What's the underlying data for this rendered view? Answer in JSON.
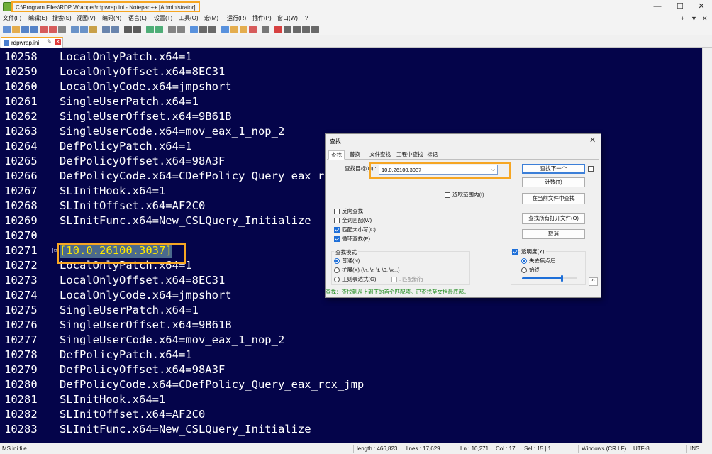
{
  "window": {
    "title": "C:\\Program Files\\RDP Wrapper\\rdpwrap.ini - Notepad++ [Administrator]",
    "minimize": "—",
    "maximize": "☐",
    "close": "✕"
  },
  "menu": {
    "items": [
      "文件(F)",
      "编辑(E)",
      "搜索(S)",
      "视图(V)",
      "编码(N)",
      "语言(L)",
      "设置(T)",
      "工具(O)",
      "宏(M)",
      "运行(R)",
      "插件(P)",
      "窗口(W)",
      "?"
    ],
    "right": [
      "+",
      "▼",
      "✕"
    ]
  },
  "toolbar": {
    "icons": [
      "new-file-icon",
      "open-file-icon",
      "save-icon",
      "save-all-icon",
      "close-icon",
      "close-all-icon",
      "print-icon",
      "cut-icon",
      "copy-icon",
      "paste-icon",
      "undo-icon",
      "redo-icon",
      "find-icon",
      "replace-icon",
      "zoom-in-icon",
      "zoom-out-icon",
      "sync-v-icon",
      "sync-h-icon",
      "word-wrap-icon",
      "show-all-icon",
      "indent-guide-icon",
      "udl-icon",
      "doc-map-icon",
      "function-list-icon",
      "folder-workspace-icon",
      "monitor-icon",
      "record-macro-icon",
      "stop-macro-icon",
      "play-macro-icon",
      "run-macro-icon",
      "save-macro-icon"
    ],
    "colors": [
      "#4a7fcf",
      "#e0a030",
      "#3a6fbf",
      "#3a6fbf",
      "#d04040",
      "#d04040",
      "#707070",
      "#5080c0",
      "#5080c0",
      "#c0902a",
      "#5070a0",
      "#5070a0",
      "#404040",
      "#404040",
      "#30a060",
      "#30a060",
      "#707070",
      "#707070",
      "#3c7fd8",
      "#505050",
      "#505050",
      "#3c7fd8",
      "#e0a030",
      "#e0a030",
      "#d04040",
      "#606060",
      "#d02020",
      "#505050",
      "#505050",
      "#505050",
      "#505050"
    ]
  },
  "tab": {
    "label": "rdpwrap.ini",
    "pin": "✎",
    "close": "✕"
  },
  "editor": {
    "lines": [
      {
        "num": "10258",
        "code": "LocalOnlyPatch.x64=1"
      },
      {
        "num": "10259",
        "code": "LocalOnlyOffset.x64=8EC31"
      },
      {
        "num": "10260",
        "code": "LocalOnlyCode.x64=jmpshort"
      },
      {
        "num": "10261",
        "code": "SingleUserPatch.x64=1"
      },
      {
        "num": "10262",
        "code": "SingleUserOffset.x64=9B61B"
      },
      {
        "num": "10263",
        "code": "SingleUserCode.x64=mov_eax_1_nop_2"
      },
      {
        "num": "10264",
        "code": "DefPolicyPatch.x64=1"
      },
      {
        "num": "10265",
        "code": "DefPolicyOffset.x64=98A3F"
      },
      {
        "num": "10266",
        "code": "DefPolicyCode.x64=CDefPolicy_Query_eax_rcx_jmp"
      },
      {
        "num": "10267",
        "code": "SLInitHook.x64=1"
      },
      {
        "num": "10268",
        "code": "SLInitOffset.x64=AF2C0"
      },
      {
        "num": "10269",
        "code": "SLInitFunc.x64=New_CSLQuery_Initialize"
      },
      {
        "num": "10270",
        "code": ""
      },
      {
        "num": "10271",
        "code": "[10.0.26100.3037]"
      },
      {
        "num": "10272",
        "code": "LocalOnlyPatch.x64=1"
      },
      {
        "num": "10273",
        "code": "LocalOnlyOffset.x64=8EC31"
      },
      {
        "num": "10274",
        "code": "LocalOnlyCode.x64=jmpshort"
      },
      {
        "num": "10275",
        "code": "SingleUserPatch.x64=1"
      },
      {
        "num": "10276",
        "code": "SingleUserOffset.x64=9B61B"
      },
      {
        "num": "10277",
        "code": "SingleUserCode.x64=mov_eax_1_nop_2"
      },
      {
        "num": "10278",
        "code": "DefPolicyPatch.x64=1"
      },
      {
        "num": "10279",
        "code": "DefPolicyOffset.x64=98A3F"
      },
      {
        "num": "10280",
        "code": "DefPolicyCode.x64=CDefPolicy_Query_eax_rcx_jmp"
      },
      {
        "num": "10281",
        "code": "SLInitHook.x64=1"
      },
      {
        "num": "10282",
        "code": "SLInitOffset.x64=AF2C0"
      },
      {
        "num": "10283",
        "code": "SLInitFunc.x64=New_CSLQuery_Initialize"
      }
    ],
    "fold_marker": "⊟",
    "background": "#04044a",
    "highlight_color": "#ffea00"
  },
  "status": {
    "filetype": "MS ini file",
    "length": "length : 466,823",
    "lines": "lines : 17,629",
    "ln": "Ln : 10,271",
    "col": "Col : 17",
    "sel": "Sel : 15 | 1",
    "eol": "Windows (CR LF)",
    "encoding": "UTF-8",
    "mode": "INS"
  },
  "find_dialog": {
    "title": "查找",
    "close": "✕",
    "tabs": [
      "查找",
      "替换",
      "文件查找",
      "工程中查找",
      "标记"
    ],
    "find_label": "查找目标(N) :",
    "find_value": "10.0.26100.3037",
    "combo_arrow": "⌵",
    "in_selection": "选取范围内(I)",
    "buttons": {
      "find_next": "查找下一个",
      "count": "计数(T)",
      "find_all_current": "在当前文件中查找",
      "find_all_open": "查找所有打开文件(O)",
      "cancel": "取消"
    },
    "options": {
      "backward": "反向查找",
      "whole_word": "全词匹配(W)",
      "match_case": "匹配大小写(C)",
      "wrap": "循环查找(P)"
    },
    "search_mode_label": "查找模式",
    "modes": {
      "normal": "普通(N)",
      "extended": "扩展(X) (\\n, \\r, \\t, \\0, \\x...)",
      "regex": "正则表达式(G)",
      "dot_newline": ". 匹配新行"
    },
    "transparency_label": "透明度(Y)",
    "transparency_modes": {
      "on_lose_focus": "失去焦点后",
      "always": "始终"
    },
    "transparency_level": 0.72,
    "collapse": "^",
    "status_text": "查找：查找到从上到下的首个匹配项。已查找至文档最底部。",
    "accent": "#1e6fd8",
    "status_color": "#1a8a1a"
  }
}
